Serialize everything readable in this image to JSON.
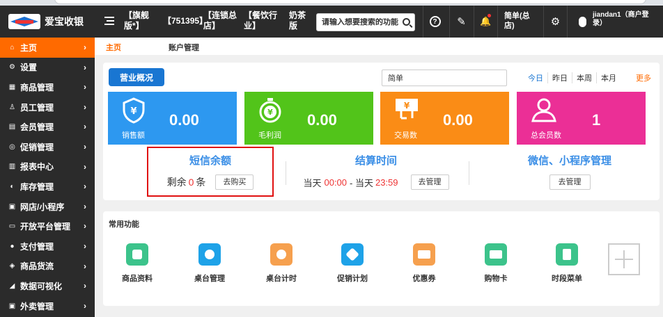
{
  "app": {
    "name": "爱宝收银"
  },
  "header": {
    "tags": [
      "【旗舰版*】",
      "【751395】",
      "【连锁总店】",
      "【餐饮行业】",
      "奶茶版"
    ],
    "search_placeholder": "请输入想要搜索的功能",
    "help_icon": "?",
    "edit_icon": "✎",
    "bell_icon": "🔔",
    "store_label": "简单(总店)",
    "settings_icon": "⚙",
    "user_label": "jiandan1（商户登录）"
  },
  "sidebar": {
    "items": [
      {
        "label": "主页",
        "icon": "home-icon",
        "glyph": "⌂"
      },
      {
        "label": "设置",
        "icon": "gear-icon",
        "glyph": "⚙"
      },
      {
        "label": "商品管理",
        "icon": "box-icon",
        "glyph": "▦"
      },
      {
        "label": "员工管理",
        "icon": "staff-icon",
        "glyph": "♙"
      },
      {
        "label": "会员管理",
        "icon": "member-icon",
        "glyph": "▤"
      },
      {
        "label": "促销管理",
        "icon": "promo-icon",
        "glyph": "◎"
      },
      {
        "label": "报表中心",
        "icon": "chart-icon",
        "glyph": "▥"
      },
      {
        "label": "库存管理",
        "icon": "stock-icon",
        "glyph": "◐"
      },
      {
        "label": "网店/小程序",
        "icon": "shop-icon",
        "glyph": "▣"
      },
      {
        "label": "开放平台管理",
        "icon": "monitor-icon",
        "glyph": "▭"
      },
      {
        "label": "支付管理",
        "icon": "pay-icon",
        "glyph": "●"
      },
      {
        "label": "商品货流",
        "icon": "flow-icon",
        "glyph": "◈"
      },
      {
        "label": "数据可视化",
        "icon": "visual-icon",
        "glyph": "◢"
      },
      {
        "label": "外卖管理",
        "icon": "delivery-icon",
        "glyph": "▣"
      }
    ],
    "chevron": "›"
  },
  "tabs": [
    {
      "label": "主页"
    },
    {
      "label": "账户管理"
    }
  ],
  "overview": {
    "button": "营业概况",
    "select_value": "简单",
    "periods": [
      "今日",
      "昨日",
      "本周",
      "本月"
    ],
    "more": "更多",
    "stats": [
      {
        "label": "销售额",
        "value": "0.00",
        "color": "#2d98f0"
      },
      {
        "label": "毛利润",
        "value": "0.00",
        "color": "#52c41a"
      },
      {
        "label": "交易数",
        "value": "0.00",
        "color": "#fa8c16"
      },
      {
        "label": "总会员数",
        "value": "1",
        "color": "#eb2f96"
      }
    ]
  },
  "sms": {
    "title": "短信余额",
    "prefix": "剩余",
    "count": "0",
    "unit": "条",
    "button": "去购买"
  },
  "settle": {
    "title": "结算时间",
    "label1": "当天",
    "time1": "00:00",
    "sep": "- 当天",
    "time2": "23:59",
    "button": "去管理"
  },
  "wechat": {
    "title": "微信、小程序管理",
    "button": "去管理"
  },
  "common": {
    "title": "常用功能",
    "functions": [
      {
        "label": "商品资料",
        "color": "#3cc38b"
      },
      {
        "label": "桌台管理",
        "color": "#1ea2e8"
      },
      {
        "label": "桌台计时",
        "color": "#f6a04e"
      },
      {
        "label": "促销计划",
        "color": "#1ea2e8"
      },
      {
        "label": "优惠券",
        "color": "#f6a04e"
      },
      {
        "label": "购物卡",
        "color": "#3cc38b"
      },
      {
        "label": "时段菜单",
        "color": "#3cc38b"
      }
    ]
  }
}
